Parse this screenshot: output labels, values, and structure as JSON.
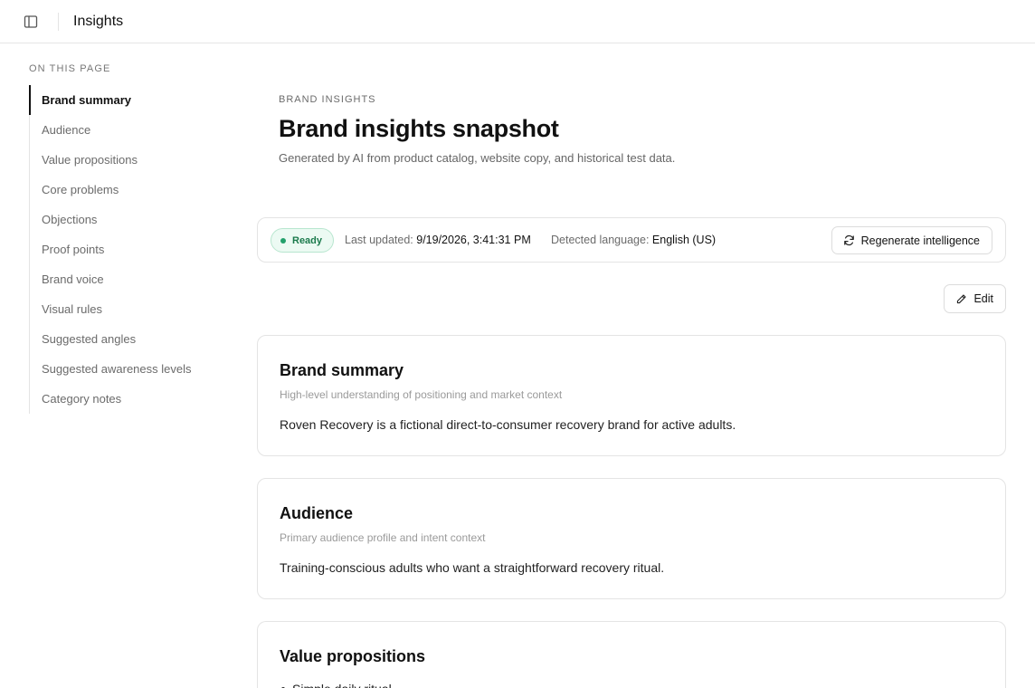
{
  "header": {
    "title": "Insights",
    "toggle_icon": "sidebar-toggle-icon"
  },
  "toc": {
    "heading": "ON THIS PAGE",
    "items": [
      {
        "label": "Brand summary",
        "active": true
      },
      {
        "label": "Audience"
      },
      {
        "label": "Value propositions"
      },
      {
        "label": "Core problems"
      },
      {
        "label": "Objections"
      },
      {
        "label": "Proof points"
      },
      {
        "label": "Brand voice"
      },
      {
        "label": "Visual rules"
      },
      {
        "label": "Suggested angles"
      },
      {
        "label": "Suggested awareness levels"
      },
      {
        "label": "Category notes"
      }
    ]
  },
  "page": {
    "eyebrow": "BRAND INSIGHTS",
    "title": "Brand insights snapshot",
    "subtitle": "Generated by AI from product catalog, website copy, and historical test data."
  },
  "status": {
    "badge": "Ready",
    "updated_label": "Last updated:",
    "updated_value": "9/19/2026, 3:41:31 PM",
    "language_label": "Detected language:",
    "language_value": "English (US)",
    "regenerate_label": "Regenerate intelligence"
  },
  "edit_label": "Edit",
  "cards": {
    "brand_summary": {
      "title": "Brand summary",
      "description": "High-level understanding of positioning and market context",
      "body": "Roven Recovery is a fictional direct-to-consumer recovery brand for active adults."
    },
    "audience": {
      "title": "Audience",
      "description": "Primary audience profile and intent context",
      "body": "Training-conscious adults who want a straightforward recovery ritual."
    },
    "value_propositions": {
      "title": "Value propositions",
      "items": [
        "Simple daily ritual"
      ]
    }
  },
  "colors": {
    "accent": "#111111",
    "ready_green": "#22a06b",
    "ready_bg": "#ecfaf3",
    "border": "#e4e4e4"
  }
}
